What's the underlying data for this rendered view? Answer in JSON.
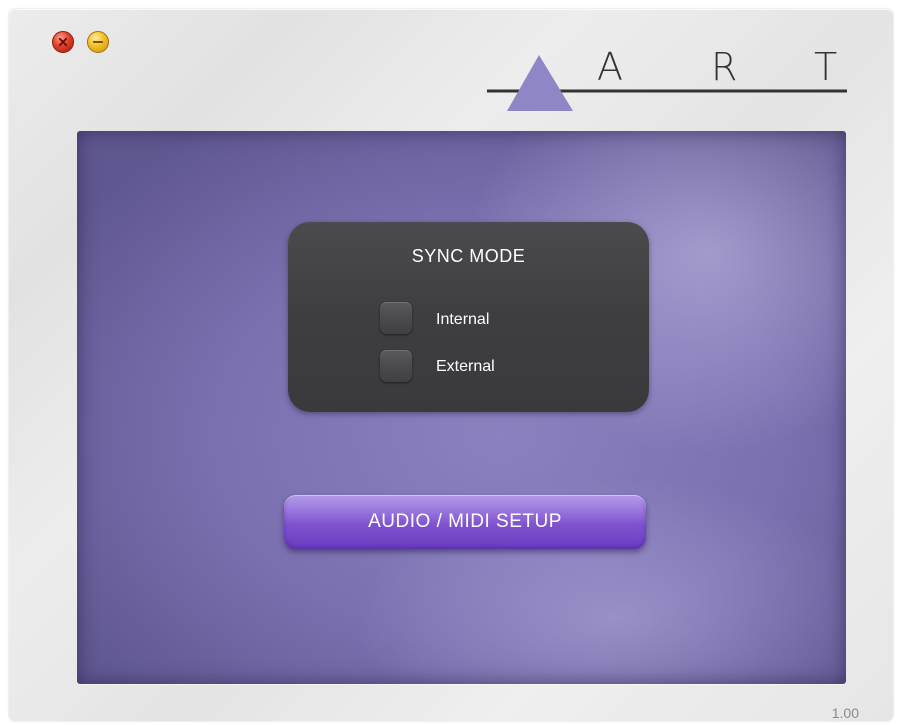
{
  "window": {
    "controls": {
      "close_icon": "close-icon",
      "minimize_icon": "minimize-icon"
    }
  },
  "logo": {
    "letters": [
      "A",
      "R",
      "T"
    ],
    "triangle_color": "#8f86c6"
  },
  "sync_mode": {
    "title": "SYNC MODE",
    "options": [
      {
        "label": "Internal",
        "selected": false
      },
      {
        "label": "External",
        "selected": false
      }
    ]
  },
  "setup_button": {
    "label": "AUDIO / MIDI SETUP"
  },
  "version": "1.00",
  "colors": {
    "panel": "#7a70b0",
    "sync_box": "#3e3e40",
    "button": "#8258d2"
  }
}
